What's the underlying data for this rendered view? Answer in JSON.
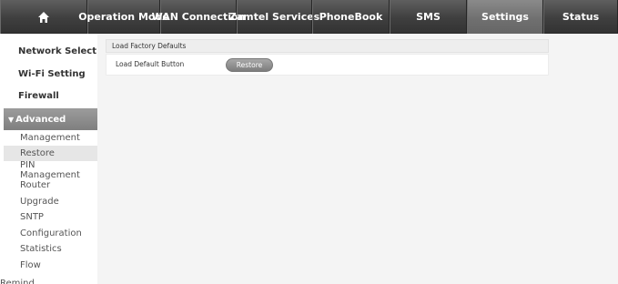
{
  "nav": {
    "home_icon": "home-icon",
    "items": [
      {
        "label": "Operation Mode"
      },
      {
        "label": "WAN Connection"
      },
      {
        "label": "Zamtel Services"
      },
      {
        "label": "PhoneBook"
      },
      {
        "label": "SMS"
      },
      {
        "label": "Settings",
        "active": true
      },
      {
        "label": "Status"
      }
    ]
  },
  "sidebar": {
    "main_items": [
      {
        "label": "Network Select"
      },
      {
        "label": "Wi-Fi Setting"
      },
      {
        "label": "Firewall"
      }
    ],
    "advanced": {
      "label": "Advanced",
      "expanded": true
    },
    "sub_items": [
      {
        "label": "Management"
      },
      {
        "label": "Restore",
        "active": true
      },
      {
        "label": "PIN Management"
      },
      {
        "label": "Router"
      },
      {
        "label": "Upgrade"
      },
      {
        "label": "SNTP"
      },
      {
        "label": "Configuration"
      },
      {
        "label": "Statistics"
      },
      {
        "label": "Flow"
      }
    ],
    "remind": "Remind"
  },
  "panel": {
    "header": "Load Factory Defaults",
    "row_label": "Load Default Button",
    "button_label": "Restore"
  },
  "colors": {
    "nav_bg": "#3f3f3f",
    "nav_active": "#707070",
    "content_bg": "#f4f4f4",
    "advanced_bg": "#8a8a8a"
  }
}
